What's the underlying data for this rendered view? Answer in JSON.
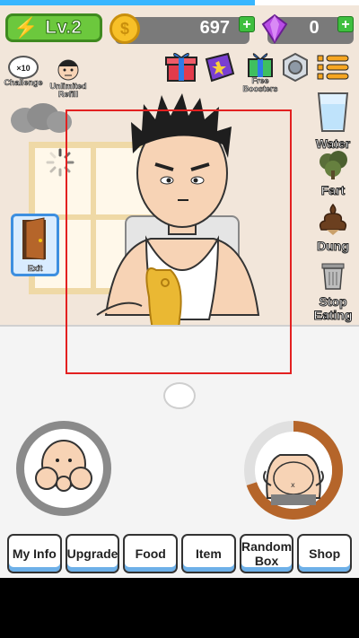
{
  "progress": {
    "fraction": 0.71,
    "color": "#38b6ff"
  },
  "hud": {
    "level": "Lv.2",
    "coins": "697",
    "gems": "0",
    "coin_plus": "+",
    "gem_plus": "+"
  },
  "left_icons": {
    "challenge_count": "×10",
    "challenge_label": "Challenge",
    "refill_label": "Unlimited Refill",
    "exit_label": "Exit"
  },
  "top_icons": {
    "free_boosters_label": "Free Boosters"
  },
  "right_icons": [
    {
      "label": "Water"
    },
    {
      "label": "Fart"
    },
    {
      "label": "Dung"
    },
    {
      "label": "Stop Eating"
    }
  ],
  "bottom_buttons": [
    {
      "label": "My Info"
    },
    {
      "label": "Upgrade"
    },
    {
      "label": "Food"
    },
    {
      "label": "Item"
    },
    {
      "label": "Random Box"
    },
    {
      "label": "Shop"
    }
  ],
  "meters": {
    "stomach_fill": 0.7
  },
  "icons": [
    "lightning-icon",
    "coin-icon",
    "gem-icon",
    "gift-icon",
    "book-icon",
    "free-booster-icon",
    "settings-nut-icon",
    "menu-list-icon",
    "water-glass-icon",
    "fart-cloud-icon",
    "dung-icon",
    "trash-can-icon",
    "door-icon",
    "egg-icon"
  ]
}
